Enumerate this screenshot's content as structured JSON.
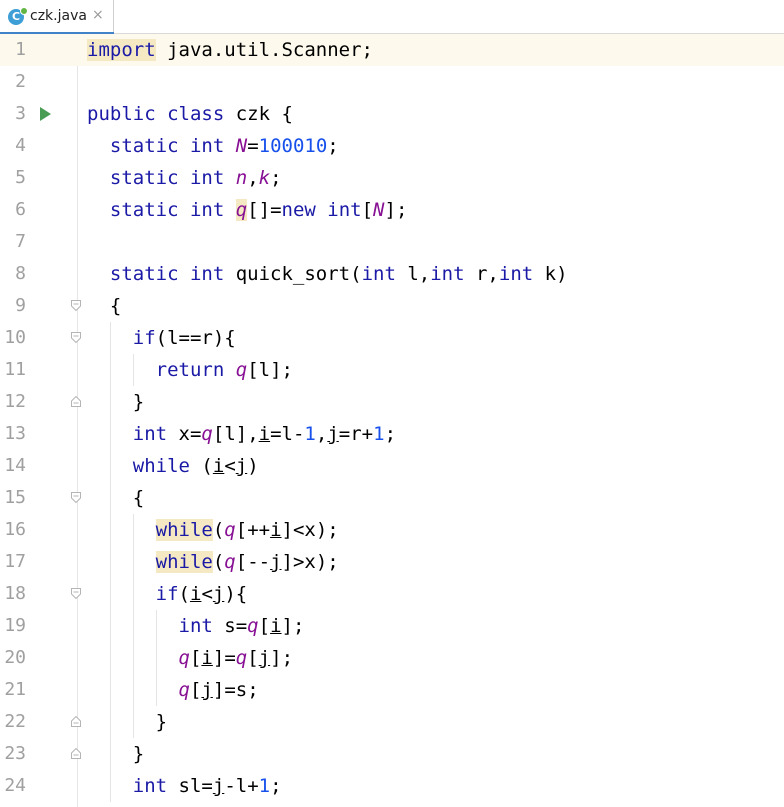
{
  "tab": {
    "icon_letter": "C",
    "filename": "czk.java",
    "close": "×"
  },
  "lines": [
    {
      "n": "1",
      "tokens": [
        {
          "t": "import",
          "c": "kw hl"
        },
        {
          "t": " java.util.Scanner;"
        }
      ]
    },
    {
      "n": "2",
      "tokens": []
    },
    {
      "n": "3",
      "tokens": [
        {
          "t": "public class",
          "c": "kw"
        },
        {
          "t": " czk {"
        }
      ]
    },
    {
      "n": "4",
      "tokens": [
        {
          "t": "  "
        },
        {
          "t": "static int",
          "c": "kw"
        },
        {
          "t": " "
        },
        {
          "t": "N",
          "c": "fld"
        },
        {
          "t": "="
        },
        {
          "t": "100010",
          "c": "num"
        },
        {
          "t": ";"
        }
      ]
    },
    {
      "n": "5",
      "tokens": [
        {
          "t": "  "
        },
        {
          "t": "static int",
          "c": "kw"
        },
        {
          "t": " "
        },
        {
          "t": "n",
          "c": "fld"
        },
        {
          "t": ","
        },
        {
          "t": "k",
          "c": "fld"
        },
        {
          "t": ";"
        }
      ]
    },
    {
      "n": "6",
      "tokens": [
        {
          "t": "  "
        },
        {
          "t": "static int",
          "c": "kw"
        },
        {
          "t": " "
        },
        {
          "t": "q",
          "c": "fld hl"
        },
        {
          "t": "[]="
        },
        {
          "t": "new int",
          "c": "kw"
        },
        {
          "t": "["
        },
        {
          "t": "N",
          "c": "fld"
        },
        {
          "t": "];"
        }
      ]
    },
    {
      "n": "7",
      "tokens": []
    },
    {
      "n": "8",
      "tokens": [
        {
          "t": "  "
        },
        {
          "t": "static int",
          "c": "kw"
        },
        {
          "t": " quick_sort("
        },
        {
          "t": "int",
          "c": "kw"
        },
        {
          "t": " l,"
        },
        {
          "t": "int",
          "c": "kw"
        },
        {
          "t": " r,"
        },
        {
          "t": "int",
          "c": "kw"
        },
        {
          "t": " k)"
        }
      ]
    },
    {
      "n": "9",
      "tokens": [
        {
          "t": "  {"
        }
      ]
    },
    {
      "n": "10",
      "tokens": [
        {
          "t": "    "
        },
        {
          "t": "if",
          "c": "kw"
        },
        {
          "t": "(l==r){"
        }
      ]
    },
    {
      "n": "11",
      "tokens": [
        {
          "t": "      "
        },
        {
          "t": "return",
          "c": "kw"
        },
        {
          "t": " "
        },
        {
          "t": "q",
          "c": "fld"
        },
        {
          "t": "[l];"
        }
      ]
    },
    {
      "n": "12",
      "tokens": [
        {
          "t": "    }"
        }
      ]
    },
    {
      "n": "13",
      "tokens": [
        {
          "t": "    "
        },
        {
          "t": "int",
          "c": "kw"
        },
        {
          "t": " x="
        },
        {
          "t": "q",
          "c": "fld"
        },
        {
          "t": "[l],"
        },
        {
          "t": "i",
          "c": "ul"
        },
        {
          "t": "=l-"
        },
        {
          "t": "1",
          "c": "num"
        },
        {
          "t": ","
        },
        {
          "t": "j",
          "c": "ul"
        },
        {
          "t": "=r+"
        },
        {
          "t": "1",
          "c": "num"
        },
        {
          "t": ";"
        }
      ]
    },
    {
      "n": "14",
      "tokens": [
        {
          "t": "    "
        },
        {
          "t": "while",
          "c": "kw"
        },
        {
          "t": " ("
        },
        {
          "t": "i",
          "c": "ul"
        },
        {
          "t": "<"
        },
        {
          "t": "j",
          "c": "ul"
        },
        {
          "t": ")"
        }
      ]
    },
    {
      "n": "15",
      "tokens": [
        {
          "t": "    {"
        }
      ]
    },
    {
      "n": "16",
      "tokens": [
        {
          "t": "      "
        },
        {
          "t": "while",
          "c": "kw hl"
        },
        {
          "t": "("
        },
        {
          "t": "q",
          "c": "fld"
        },
        {
          "t": "[++"
        },
        {
          "t": "i",
          "c": "ul"
        },
        {
          "t": "]<x);"
        }
      ]
    },
    {
      "n": "17",
      "tokens": [
        {
          "t": "      "
        },
        {
          "t": "while",
          "c": "kw hl"
        },
        {
          "t": "("
        },
        {
          "t": "q",
          "c": "fld"
        },
        {
          "t": "[--"
        },
        {
          "t": "j",
          "c": "ul"
        },
        {
          "t": "]>x);"
        }
      ]
    },
    {
      "n": "18",
      "tokens": [
        {
          "t": "      "
        },
        {
          "t": "if",
          "c": "kw"
        },
        {
          "t": "("
        },
        {
          "t": "i",
          "c": "ul"
        },
        {
          "t": "<"
        },
        {
          "t": "j",
          "c": "ul"
        },
        {
          "t": "){"
        }
      ]
    },
    {
      "n": "19",
      "tokens": [
        {
          "t": "        "
        },
        {
          "t": "int",
          "c": "kw"
        },
        {
          "t": " s="
        },
        {
          "t": "q",
          "c": "fld"
        },
        {
          "t": "["
        },
        {
          "t": "i",
          "c": "ul"
        },
        {
          "t": "];"
        }
      ]
    },
    {
      "n": "20",
      "tokens": [
        {
          "t": "        "
        },
        {
          "t": "q",
          "c": "fld"
        },
        {
          "t": "["
        },
        {
          "t": "i",
          "c": "ul"
        },
        {
          "t": "]="
        },
        {
          "t": "q",
          "c": "fld"
        },
        {
          "t": "["
        },
        {
          "t": "j",
          "c": "ul"
        },
        {
          "t": "];"
        }
      ]
    },
    {
      "n": "21",
      "tokens": [
        {
          "t": "        "
        },
        {
          "t": "q",
          "c": "fld"
        },
        {
          "t": "["
        },
        {
          "t": "j",
          "c": "ul"
        },
        {
          "t": "]=s;"
        }
      ]
    },
    {
      "n": "22",
      "tokens": [
        {
          "t": "      }"
        }
      ]
    },
    {
      "n": "23",
      "tokens": [
        {
          "t": "    }"
        }
      ]
    },
    {
      "n": "24",
      "tokens": [
        {
          "t": "    "
        },
        {
          "t": "int",
          "c": "kw"
        },
        {
          "t": " sl="
        },
        {
          "t": "j",
          "c": "ul"
        },
        {
          "t": "-l+"
        },
        {
          "t": "1",
          "c": "num"
        },
        {
          "t": ";"
        }
      ]
    }
  ],
  "current_line": "1",
  "run_marker_line": "3",
  "fold_open_lines": [
    "9",
    "10",
    "15",
    "18"
  ],
  "fold_close_lines": [
    "12",
    "22",
    "23"
  ],
  "colors": {
    "keyword": "#1a1aa6",
    "number": "#1750eb",
    "field": "#871094",
    "line_number": "#a0a0a0",
    "run_icon": "#499c54"
  }
}
